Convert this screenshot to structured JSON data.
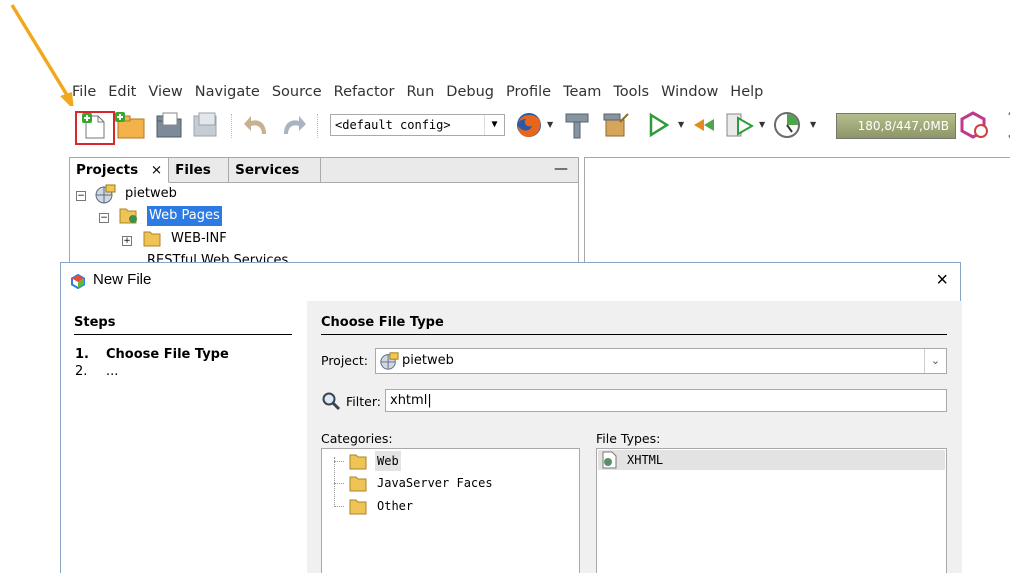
{
  "menu": [
    "File",
    "Edit",
    "View",
    "Navigate",
    "Source",
    "Refactor",
    "Run",
    "Debug",
    "Profile",
    "Team",
    "Tools",
    "Window",
    "Help"
  ],
  "toolbar": {
    "config_value": "<default config>",
    "memory": "180,8/447,0MB"
  },
  "projects_panel": {
    "tabs": [
      {
        "label": "Projects",
        "close": "×"
      },
      {
        "label": "Files"
      },
      {
        "label": "Services"
      }
    ],
    "minimize": "—",
    "tree": {
      "root": "pietweb",
      "web_pages": "Web Pages",
      "web_inf": "WEB-INF",
      "restful": "RESTful Web Services"
    }
  },
  "dialog": {
    "title": "New File",
    "close": "×",
    "steps_heading": "Steps",
    "steps": [
      {
        "num": "1.",
        "label": "Choose File Type"
      },
      {
        "num": "2.",
        "label": "..."
      }
    ],
    "content_heading": "Choose File Type",
    "project_label": "Project:",
    "project_value": "pietweb",
    "filter_label": "Filter:",
    "filter_value": "xhtml",
    "categories_label": "Categories:",
    "categories": [
      "Web",
      "JavaServer Faces",
      "Other"
    ],
    "file_types_label": "File Types:",
    "file_types": [
      "XHTML"
    ]
  },
  "colors": {
    "highlight_box": "#d9262a",
    "arrow": "#f2a81d",
    "selection": "#2c7be5"
  }
}
